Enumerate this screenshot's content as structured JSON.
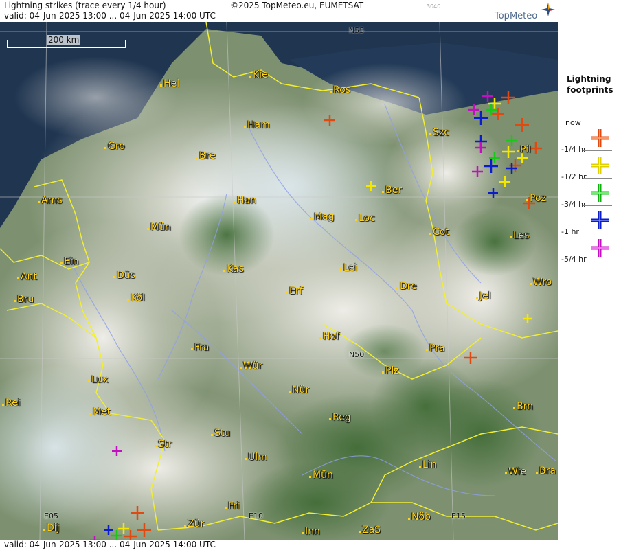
{
  "header": {
    "title": "Lightning strikes (trace every 1/4 hour)",
    "valid_line": "valid:  04-Jun-2025 13:00 ... 04-Jun-2025 14:00 UTC",
    "copyright": "©2025 TopMeteo.eu, EUMETSAT",
    "image_code": "3040",
    "logo_text": "TopMeteo"
  },
  "footer": {
    "valid_line": "valid:  04-Jun-2025 13:00 ... 04-Jun-2025 14:00 UTC"
  },
  "scale": {
    "label": "200 km"
  },
  "legend": {
    "title_line1": "Lightning",
    "title_line2": "footprints",
    "items": [
      {
        "label": "now",
        "color": ""
      },
      {
        "label": "-1/4 hr",
        "color": "#e04a10"
      },
      {
        "label": "-1/2 hr",
        "color": "#f5e800"
      },
      {
        "label": "-3/4 hr",
        "color": "#18c818"
      },
      {
        "label": "-1 hr",
        "color": "#0a1ccc"
      },
      {
        "label": "-5/4 hr",
        "color": "#c010c0"
      }
    ]
  },
  "coords": {
    "n55": "N55",
    "n50": "N50",
    "e05": "E05",
    "e10": "E10",
    "e15": "E15"
  },
  "cities": {
    "hel": "Hel",
    "kie": "Kie",
    "ros": "Ros",
    "ham": "Ham",
    "szc": "Szc",
    "gro": "Gro",
    "bre": "Bre",
    "pil": "Pil",
    "ber": "Ber",
    "ams": "Ams",
    "han": "Han",
    "poz": "Poz",
    "mag": "Mag",
    "loc": "Loc",
    "mun_north": "Mün",
    "cot": "Cot",
    "les": "Les",
    "ein": "Ein",
    "kas": "Kas",
    "lei": "Lei",
    "ant": "Ant",
    "dus": "Düs",
    "wro": "Wro",
    "kol": "Köl",
    "erf": "Erf",
    "dre": "Dre",
    "bru": "Bru",
    "jel": "Jel",
    "hof": "Hof",
    "fra": "Fra",
    "pra": "Pra",
    "lux": "Lux",
    "wur": "Wür",
    "plz": "Plz",
    "rei": "Rei",
    "nur": "Nür",
    "met": "Met",
    "brn": "Brn",
    "reg": "Reg",
    "stu": "Stu",
    "str": "Str",
    "ulm": "Ulm",
    "lin": "Lin",
    "mun_south": "Mün",
    "wie": "Wie",
    "bra": "Bra",
    "fri": "Fri",
    "dij": "Dij",
    "zur": "Zür",
    "inn": "Inn",
    "zas": "ZaS",
    "nob": "Nöb"
  }
}
